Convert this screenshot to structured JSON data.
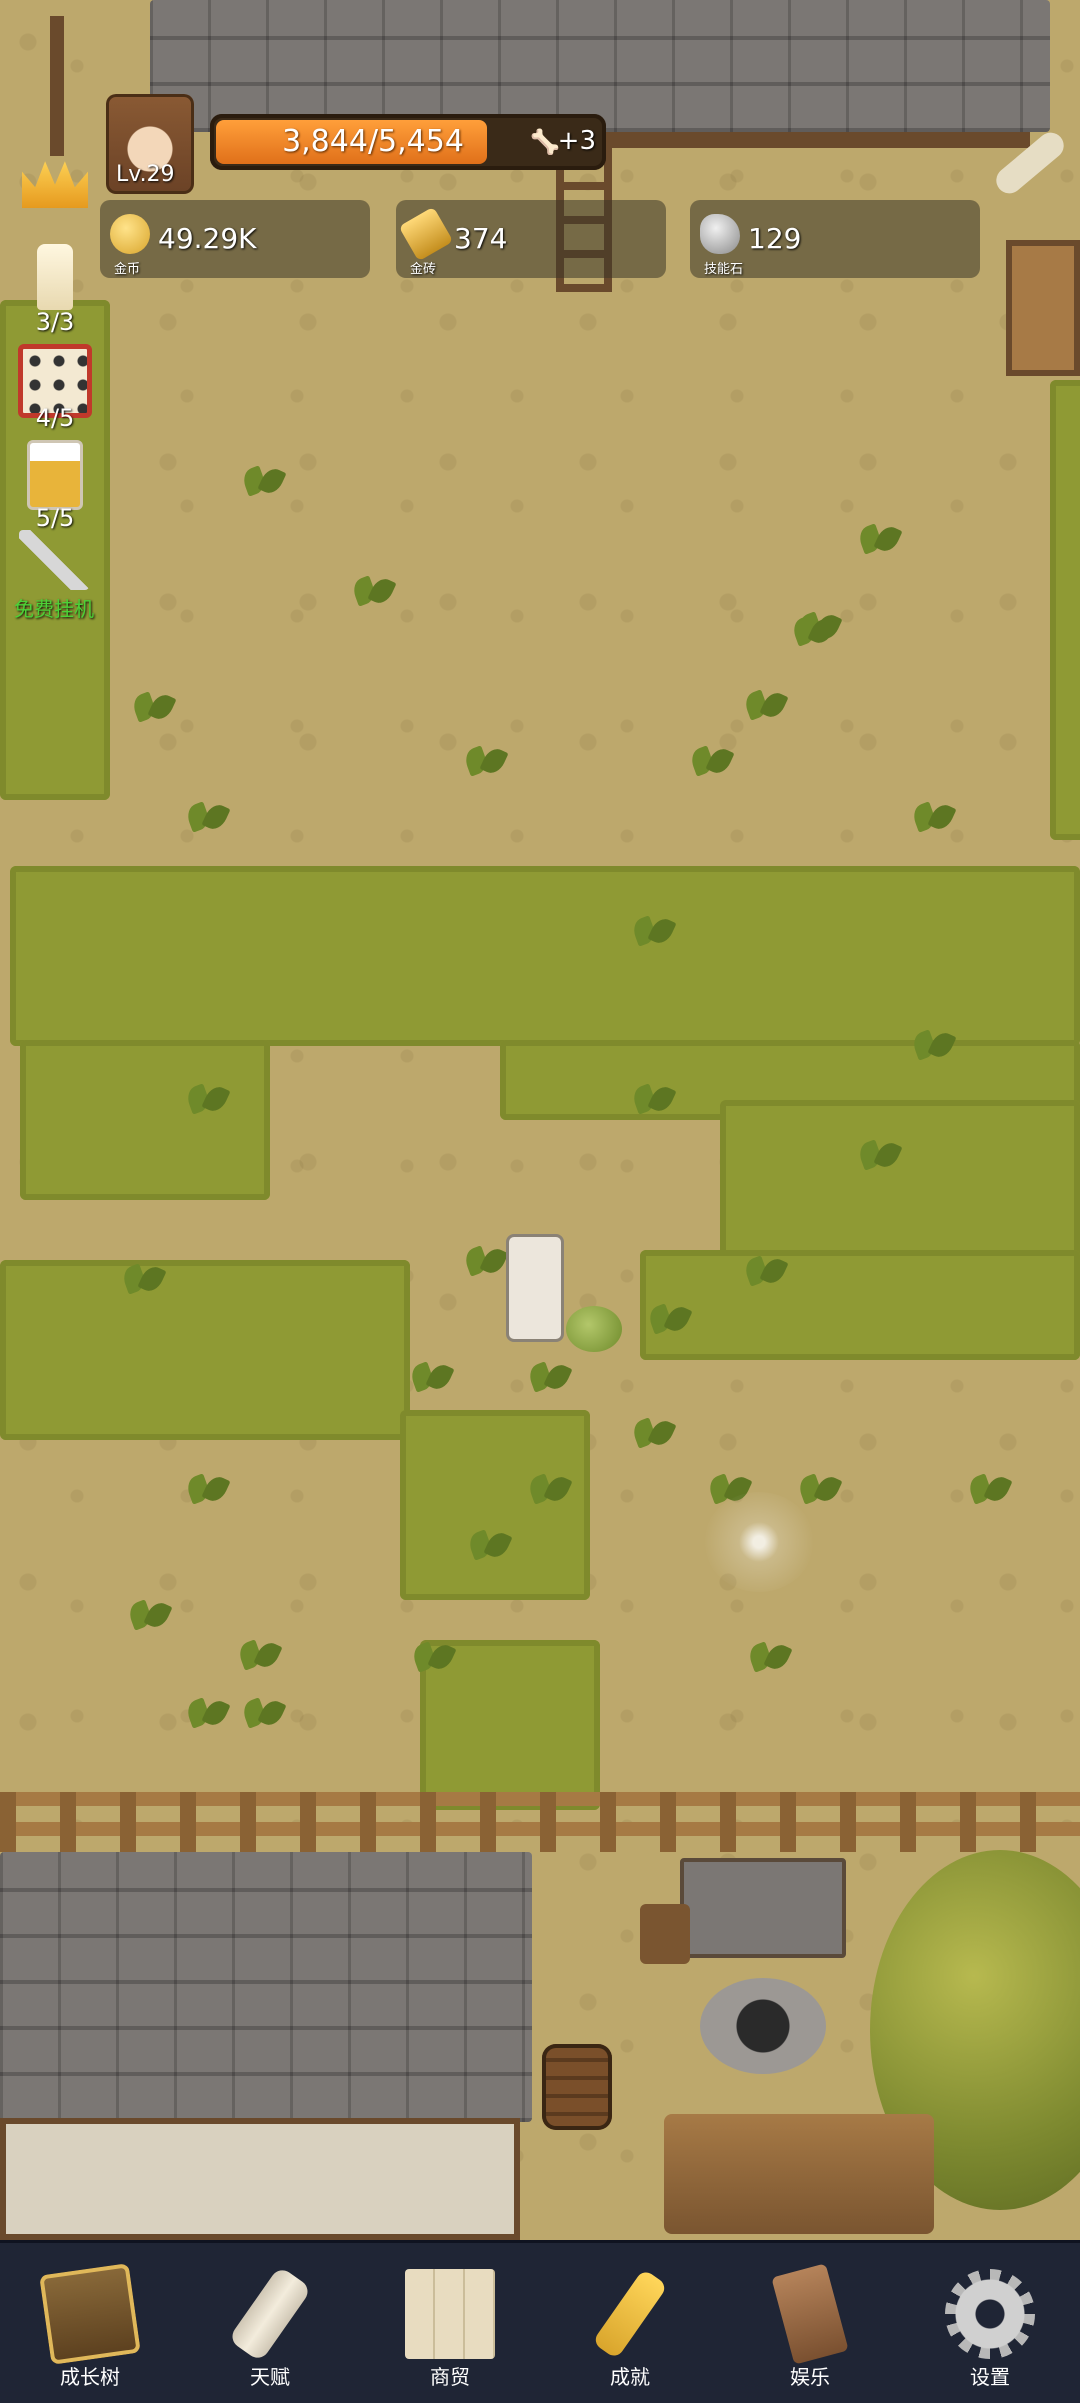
{
  "hud": {
    "level": "Lv.29",
    "xp_text": "3,844/5,454",
    "xp_current": 3844,
    "xp_max": 5454,
    "xp_bonus": "+3"
  },
  "resources": [
    {
      "value": "49.29K",
      "label": "金币",
      "icon": "gold-coin-icon",
      "color": "#e8b93a"
    },
    {
      "value": "374",
      "label": "金砖",
      "icon": "gold-brick-icon",
      "color": "#d9a52c"
    },
    {
      "value": "129",
      "label": "技能石",
      "icon": "skill-stone-icon",
      "color": "#b8b8b8"
    }
  ],
  "side_buttons": [
    {
      "name": "crown",
      "count": ""
    },
    {
      "name": "candle",
      "count": "3/3"
    },
    {
      "name": "dice",
      "count": "4/5"
    },
    {
      "name": "beer",
      "count": "5/5"
    },
    {
      "name": "key",
      "label": "免费挂机"
    }
  ],
  "nav": [
    {
      "label": "成长树",
      "icon": "book-icon"
    },
    {
      "label": "天赋",
      "icon": "scroll-icon"
    },
    {
      "label": "商贸",
      "icon": "map-icon"
    },
    {
      "label": "成就",
      "icon": "key-icon"
    },
    {
      "label": "娱乐",
      "icon": "ticket-icon"
    },
    {
      "label": "设置",
      "icon": "gear-icon"
    }
  ],
  "colors": {
    "xp_fill": "#f08a2a",
    "nav_bg": "#1f2535",
    "free_idle_text": "#4cd137"
  }
}
